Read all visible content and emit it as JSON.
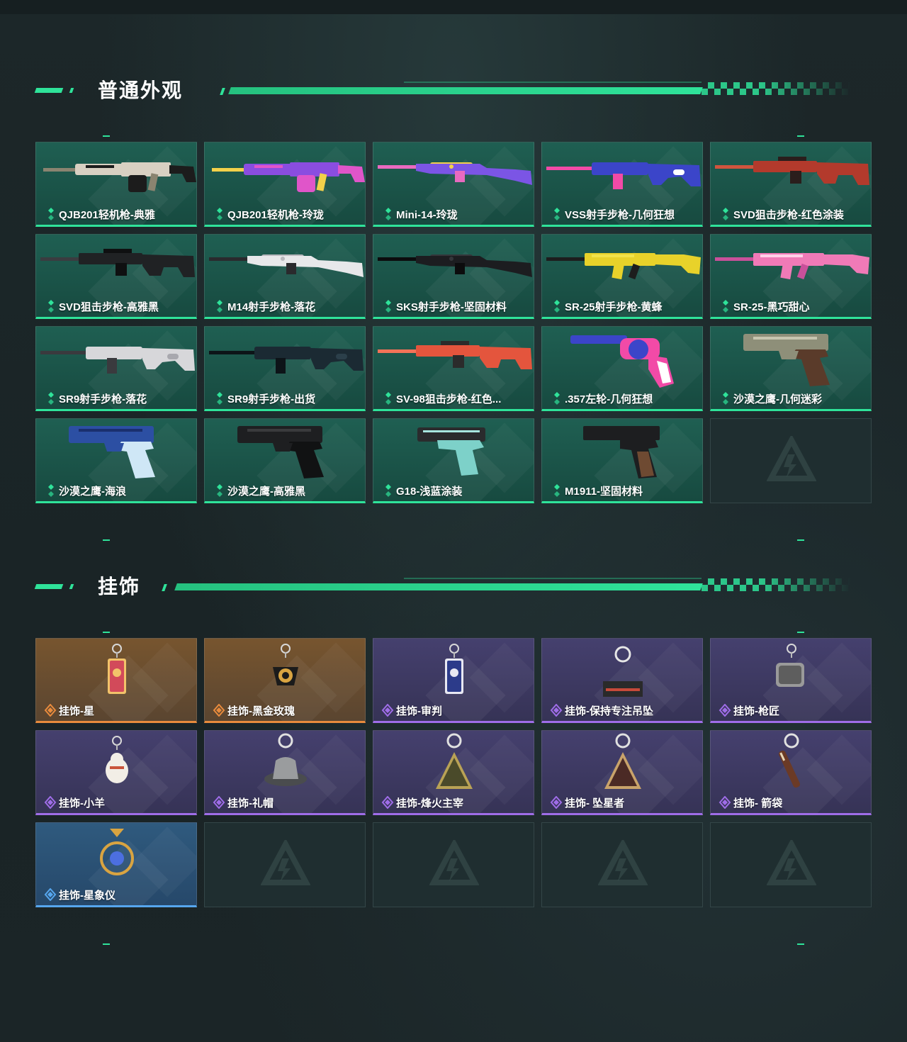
{
  "sections": {
    "skins": {
      "title": "普通外观",
      "items": [
        {
          "label": "QJB201轻机枪-典雅",
          "weapon": "lmg",
          "colors": [
            "#d8d0c2",
            "#1c1c1c",
            "#8a8470"
          ]
        },
        {
          "label": "QJB201轻机枪-玲珑",
          "weapon": "lmg",
          "colors": [
            "#8a4de0",
            "#e055c9",
            "#f2d14a"
          ]
        },
        {
          "label": "Mini-14-玲珑",
          "weapon": "rifle",
          "colors": [
            "#7b55e5",
            "#e86ac0",
            "#f2d14a"
          ]
        },
        {
          "label": "VSS射手步枪-几何狂想",
          "weapon": "dmr",
          "colors": [
            "#3b45c9",
            "#f24aa7",
            "#ffffff"
          ]
        },
        {
          "label": "SVD狙击步枪-红色涂装",
          "weapon": "sniper",
          "colors": [
            "#b33a2c",
            "#2a1e1c",
            "#d0543e"
          ]
        },
        {
          "label": "SVD狙击步枪-高雅黑",
          "weapon": "sniper",
          "colors": [
            "#202224",
            "#0f1011",
            "#3a3c40"
          ]
        },
        {
          "label": "M14射手步枪-落花",
          "weapon": "rifle",
          "colors": [
            "#e7e8ea",
            "#2a2a2d",
            "#b8b8bd"
          ]
        },
        {
          "label": "SKS射手步枪-坚固材料",
          "weapon": "rifle",
          "colors": [
            "#1c1d20",
            "#0c0c0d",
            "#34363a"
          ]
        },
        {
          "label": "SR-25射手步枪-黄蜂",
          "weapon": "ar",
          "colors": [
            "#e8d22a",
            "#1d1d1d",
            "#f2e24a"
          ]
        },
        {
          "label": "SR-25-黑巧甜心",
          "weapon": "ar",
          "colors": [
            "#f07ab7",
            "#c9509a",
            "#ffd0e8"
          ]
        },
        {
          "label": "SR9射手步枪-落花",
          "weapon": "dmr",
          "colors": [
            "#d7d7da",
            "#3a3a3e",
            "#a8a8ae"
          ]
        },
        {
          "label": "SR9射手步枪-出货",
          "weapon": "dmr",
          "colors": [
            "#1b2a33",
            "#0d1418",
            "#2b3f4a"
          ]
        },
        {
          "label": "SV-98狙击步枪-红色...",
          "weapon": "sniper",
          "colors": [
            "#e4553d",
            "#2b2b2b",
            "#f27358"
          ]
        },
        {
          "label": ".357左轮-几何狂想",
          "weapon": "revolver",
          "colors": [
            "#3b45c9",
            "#f24aa7",
            "#ffffff"
          ]
        },
        {
          "label": "沙漠之鹰-几何迷彩",
          "weapon": "pistol",
          "colors": [
            "#8e8f79",
            "#5a3b2a",
            "#c7c6b0"
          ]
        },
        {
          "label": "沙漠之鹰-海浪",
          "weapon": "pistol",
          "colors": [
            "#2c4fa3",
            "#cfe7f6",
            "#1a2f6e"
          ]
        },
        {
          "label": "沙漠之鹰-高雅黑",
          "weapon": "pistol",
          "colors": [
            "#1e1f21",
            "#111213",
            "#3a3b3d"
          ]
        },
        {
          "label": "G18-浅蓝涂装",
          "weapon": "glock",
          "colors": [
            "#7dd1c9",
            "#2a2b2d",
            "#a6e6df"
          ]
        },
        {
          "label": "M1911-坚固材料",
          "weapon": "pistol1911",
          "colors": [
            "#1d1e20",
            "#6e4a32",
            "#36383b"
          ]
        }
      ],
      "empty_slots": 1
    },
    "charms": {
      "title": "挂饰",
      "items": [
        {
          "label": "挂饰-星",
          "rarity": "orange",
          "charm": "card",
          "colors": [
            "#d24a5a",
            "#f2c36a"
          ]
        },
        {
          "label": "挂饰-黑金玫瑰",
          "rarity": "orange",
          "charm": "rose",
          "colors": [
            "#1b1b1b",
            "#d9a441"
          ]
        },
        {
          "label": "挂饰-审判",
          "rarity": "purple",
          "charm": "card",
          "colors": [
            "#2c3b8a",
            "#e8e8f2"
          ]
        },
        {
          "label": "挂饰-保持专注吊坠",
          "rarity": "purple",
          "charm": "tag",
          "colors": [
            "#2a2a2a",
            "#c84a3a"
          ]
        },
        {
          "label": "挂饰-枪匠",
          "rarity": "purple",
          "charm": "dogtag",
          "colors": [
            "#9a9a9a",
            "#5e5e5e"
          ]
        },
        {
          "label": "挂饰-小羊",
          "rarity": "purple",
          "charm": "sheep",
          "colors": [
            "#f2eee6",
            "#c9543a"
          ]
        },
        {
          "label": "挂饰-礼帽",
          "rarity": "purple",
          "charm": "hat",
          "colors": [
            "#9a9c9e",
            "#4a4c4e"
          ]
        },
        {
          "label": "挂饰-烽火主宰",
          "rarity": "purple",
          "charm": "triangle",
          "colors": [
            "#4a4a2a",
            "#b9a255"
          ]
        },
        {
          "label": "挂饰- 坠星者",
          "rarity": "purple",
          "charm": "triangle",
          "colors": [
            "#4b2a25",
            "#c9a36a"
          ]
        },
        {
          "label": "挂饰- 箭袋",
          "rarity": "purple",
          "charm": "quiver",
          "colors": [
            "#6b3a26",
            "#e7d6b5"
          ]
        },
        {
          "label": "挂饰-星象仪",
          "rarity": "blue",
          "charm": "orb",
          "colors": [
            "#d9a441",
            "#4c6fe0"
          ]
        }
      ],
      "empty_slots": 4
    }
  },
  "rarity_colors": {
    "green": "#2fe39a",
    "orange": "#e98b3d",
    "purple": "#9f6de8",
    "blue": "#56a6ee"
  },
  "accent": "#2fe39a",
  "icons": {
    "rarity": "diamond-pair-icon",
    "empty": "logo-emblem-icon"
  }
}
